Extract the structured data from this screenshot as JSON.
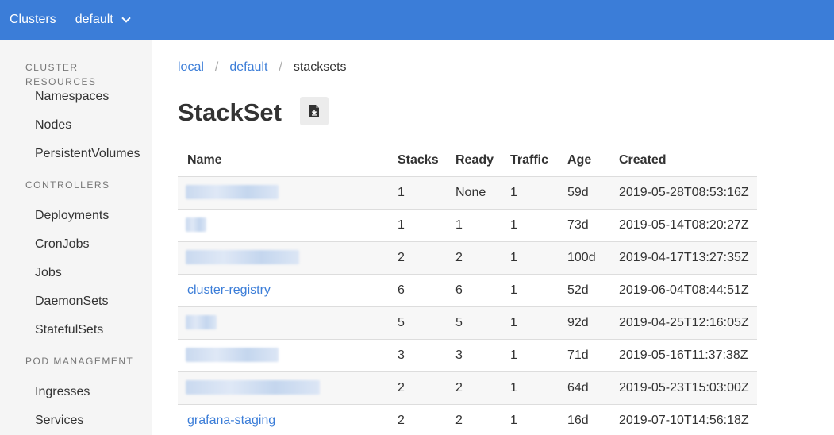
{
  "topbar": {
    "clusters_label": "Clusters",
    "context_label": "default",
    "brand_color": "#3b7dd8"
  },
  "sidebar": {
    "sections": [
      {
        "label": "CLUSTER RESOURCES",
        "items": [
          "Namespaces",
          "Nodes",
          "PersistentVolumes"
        ]
      },
      {
        "label": "CONTROLLERS",
        "items": [
          "Deployments",
          "CronJobs",
          "Jobs",
          "DaemonSets",
          "StatefulSets"
        ]
      },
      {
        "label": "POD MANAGEMENT",
        "items": [
          "Ingresses",
          "Services"
        ]
      }
    ]
  },
  "breadcrumb": {
    "cluster": "local",
    "namespace": "default",
    "current": "stacksets"
  },
  "page": {
    "title": "StackSet",
    "download_icon": "download-file-icon"
  },
  "table": {
    "headers": {
      "name": "Name",
      "stacks": "Stacks",
      "ready": "Ready",
      "traffic": "Traffic",
      "age": "Age",
      "created": "Created"
    },
    "rows": [
      {
        "name": "",
        "stacks": "1",
        "ready": "None",
        "traffic": "1",
        "age": "59d",
        "created": "2019-05-28T08:53:16Z"
      },
      {
        "name": "",
        "stacks": "1",
        "ready": "1",
        "traffic": "1",
        "age": "73d",
        "created": "2019-05-14T08:20:27Z"
      },
      {
        "name": "",
        "stacks": "2",
        "ready": "2",
        "traffic": "1",
        "age": "100d",
        "created": "2019-04-17T13:27:35Z"
      },
      {
        "name": "cluster-registry",
        "stacks": "6",
        "ready": "6",
        "traffic": "1",
        "age": "52d",
        "created": "2019-06-04T08:44:51Z"
      },
      {
        "name": "",
        "stacks": "5",
        "ready": "5",
        "traffic": "1",
        "age": "92d",
        "created": "2019-04-25T12:16:05Z"
      },
      {
        "name": "",
        "stacks": "3",
        "ready": "3",
        "traffic": "1",
        "age": "71d",
        "created": "2019-05-16T11:37:38Z"
      },
      {
        "name": "",
        "stacks": "2",
        "ready": "2",
        "traffic": "1",
        "age": "64d",
        "created": "2019-05-23T15:03:00Z"
      },
      {
        "name": "grafana-staging",
        "stacks": "2",
        "ready": "2",
        "traffic": "1",
        "age": "16d",
        "created": "2019-07-10T14:56:18Z"
      }
    ]
  }
}
